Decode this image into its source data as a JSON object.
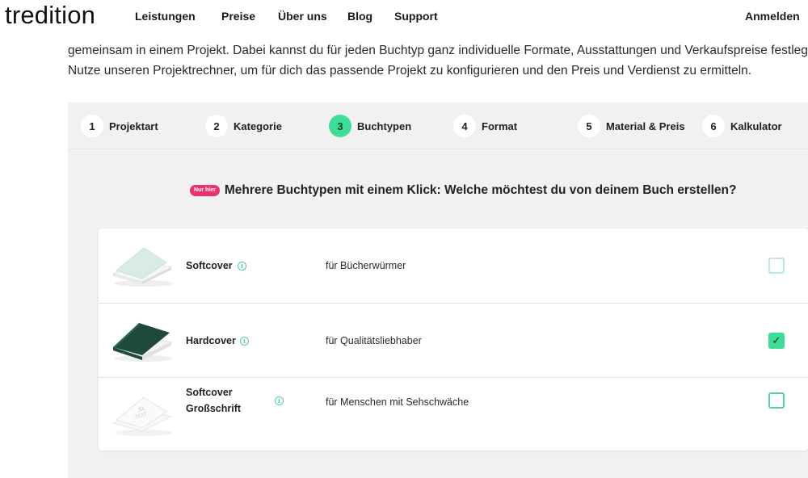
{
  "header": {
    "logo": "tredition",
    "nav": [
      {
        "label": "Leistungen"
      },
      {
        "label": "Preise"
      },
      {
        "label": "Über uns"
      },
      {
        "label": "Blog"
      },
      {
        "label": "Support"
      }
    ],
    "login": "Anmelden"
  },
  "intro": {
    "line1": "gemeinsam in einem Projekt. Dabei kannst du für jeden Buchtyp ganz individuelle Formate, Ausstattungen und Verkaufspreise festlegen.",
    "line2": "Nutze unseren Projektrechner, um für dich das passende Projekt zu konfigurieren und den Preis und Verdienst zu ermitteln."
  },
  "steps": [
    {
      "num": "1",
      "label": "Projektart",
      "active": false
    },
    {
      "num": "2",
      "label": "Kategorie",
      "active": false
    },
    {
      "num": "3",
      "label": "Buchtypen",
      "active": true
    },
    {
      "num": "4",
      "label": "Format",
      "active": false
    },
    {
      "num": "5",
      "label": "Material & Preis",
      "active": false
    },
    {
      "num": "6",
      "label": "Kalkulator",
      "active": false
    }
  ],
  "question": {
    "badge": "Nur hier",
    "text": "Mehrere Buchtypen mit einem Klick: Welche möchtest du von deinem Buch erstellen?"
  },
  "options": [
    {
      "name_line1": "Softcover",
      "name_line2": "",
      "description": "für Bücherwürmer",
      "checked": false,
      "book_icon": "softcover-book-icon"
    },
    {
      "name_line1": "Hardcover",
      "name_line2": "",
      "description": "für Qualitätsliebhaber",
      "checked": true,
      "book_icon": "hardcover-book-icon"
    },
    {
      "name_line1": "Softcover",
      "name_line2": "Großschrift",
      "description": "für Menschen mit Sehschwäche",
      "checked": false,
      "book_icon": "large-print-book-icon"
    }
  ],
  "icons": {
    "info": "i",
    "check": "✓"
  },
  "colors": {
    "accent": "#3ddc97",
    "badge": "#e8336d",
    "hardcover": "#1d4a3c"
  }
}
